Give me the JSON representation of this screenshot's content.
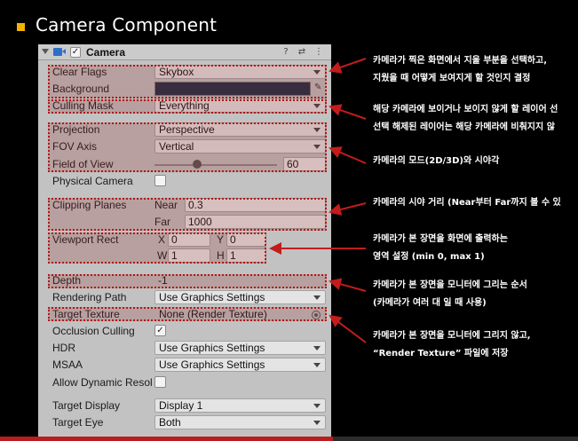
{
  "slide": {
    "title": "Camera Component"
  },
  "component": {
    "name": "Camera",
    "enabled_mark": "✓",
    "help_glyph": "?",
    "preset_glyph": "⇄",
    "menu_glyph": "⋮"
  },
  "fields": {
    "clear_flags": {
      "label": "Clear Flags",
      "value": "Skybox"
    },
    "background": {
      "label": "Background",
      "color": "#1d2f46"
    },
    "culling_mask": {
      "label": "Culling Mask",
      "value": "Everything"
    },
    "projection": {
      "label": "Projection",
      "value": "Perspective"
    },
    "fov_axis": {
      "label": "FOV Axis",
      "value": "Vertical"
    },
    "field_of_view": {
      "label": "Field of View",
      "value": "60",
      "fraction": 0.32
    },
    "physical_camera": {
      "label": "Physical Camera",
      "checked": false
    },
    "clipping_planes": {
      "label": "Clipping Planes",
      "near_label": "Near",
      "near": "0.3",
      "far_label": "Far",
      "far": "1000"
    },
    "viewport_rect": {
      "label": "Viewport Rect",
      "x_label": "X",
      "x": "0",
      "y_label": "Y",
      "y": "0",
      "w_label": "W",
      "w": "1",
      "h_label": "H",
      "h": "1"
    },
    "depth": {
      "label": "Depth",
      "value": "-1"
    },
    "rendering_path": {
      "label": "Rendering Path",
      "value": "Use Graphics Settings"
    },
    "target_texture": {
      "label": "Target Texture",
      "value": "None (Render Texture)"
    },
    "occlusion_culling": {
      "label": "Occlusion Culling",
      "check": "✓"
    },
    "hdr": {
      "label": "HDR",
      "value": "Use Graphics Settings"
    },
    "msaa": {
      "label": "MSAA",
      "value": "Use Graphics Settings"
    },
    "allow_dynamic": {
      "label": "Allow Dynamic Resol"
    },
    "target_display": {
      "label": "Target Display",
      "value": "Display 1"
    },
    "target_eye": {
      "label": "Target Eye",
      "value": "Both"
    }
  },
  "annotations": [
    {
      "line1": "카메라가 찍은 화면에서 지울 부분을 선택하고,",
      "line2": "지웠을 때 어떻게 보여지게 할 것인지 결정"
    },
    {
      "line1": "해당 카메라에 보이거나 보이지 않게 할 레이어 선",
      "line2": "선택 해제된 레이어는 해당 카메라에 비춰지지 않"
    },
    {
      "line1": "카메라의 모드(2D/3D)와 시야각"
    },
    {
      "line1": "카메라의 시야 거리 (Near부터 Far까지 볼 수 있"
    },
    {
      "line1": "카메라가 본 장면을 화면에 출력하는",
      "line2": "영역 설정 (min 0, max 1)"
    },
    {
      "line1": "카메라가 본 장면을 모니터에 그리는 순서",
      "line2": "(카메라가 여러 대 일 때 사용)"
    },
    {
      "line1": "카메라가 본 장면을 모니터에 그리지 않고,",
      "line2": "“Render Texture” 파일에 저장"
    }
  ],
  "colors": {
    "accent_red": "#b81e1e",
    "bullet": "#f2b400"
  }
}
